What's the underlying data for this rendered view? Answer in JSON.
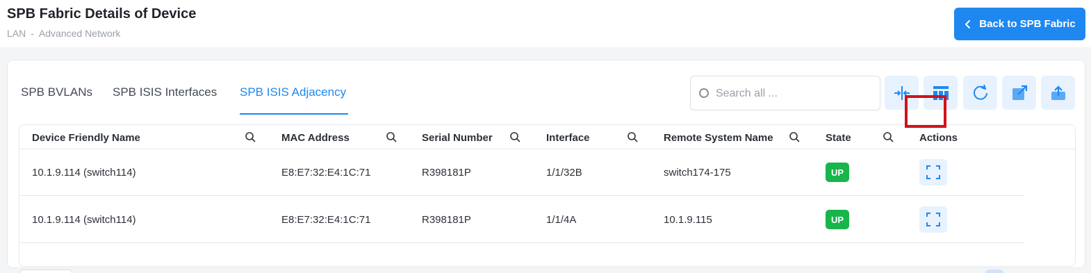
{
  "header": {
    "title": "SPB Fabric Details of Device",
    "breadcrumb": [
      "LAN",
      "-",
      "Advanced Network"
    ],
    "back_button": "Back to SPB Fabric"
  },
  "tabs": [
    {
      "label": "SPB BVLANs",
      "active": false
    },
    {
      "label": "SPB ISIS Interfaces",
      "active": false
    },
    {
      "label": "SPB ISIS Adjacency",
      "active": true
    }
  ],
  "search": {
    "placeholder": "Search all ...",
    "value": ""
  },
  "toolbar": {
    "icons": [
      "collapse-columns-icon",
      "column-settings-icon",
      "refresh-icon",
      "export-icon",
      "upload-icon"
    ]
  },
  "table": {
    "columns": [
      "Device Friendly Name",
      "MAC Address",
      "Serial Number",
      "Interface",
      "Remote System Name",
      "State",
      "Actions"
    ],
    "rows": [
      {
        "device": "10.1.9.114 (switch114)",
        "mac": "E8:E7:32:E4:1C:71",
        "serial": "R398181P",
        "interface": "1/1/32B",
        "remote": "switch174-175",
        "state": "UP"
      },
      {
        "device": "10.1.9.114 (switch114)",
        "mac": "E8:E7:32:E4:1C:71",
        "serial": "R398181P",
        "interface": "1/1/4A",
        "remote": "10.1.9.115",
        "state": "UP"
      }
    ]
  },
  "colors": {
    "accent": "#1e88f0",
    "status_up": "#18b54a",
    "highlight": "#d0121b"
  }
}
